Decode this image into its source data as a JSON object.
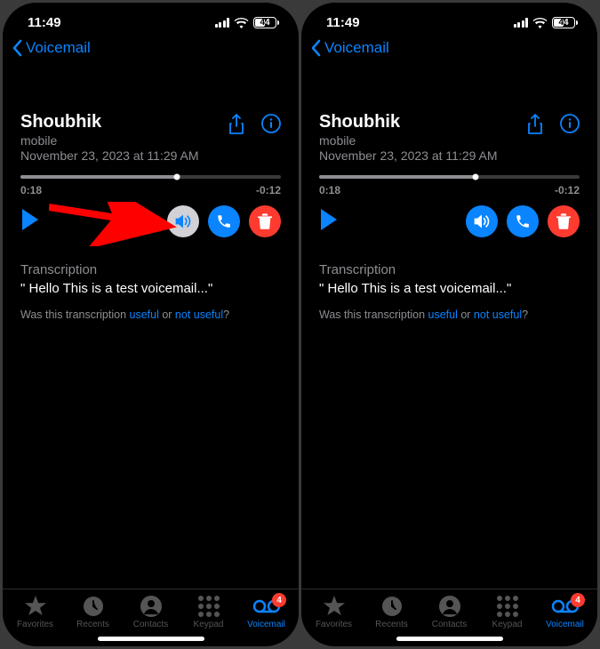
{
  "status": {
    "time": "11:49",
    "battery": "44"
  },
  "nav": {
    "back": "Voicemail"
  },
  "voicemail": {
    "name": "Shoubhik",
    "type": "mobile",
    "date": "November 23, 2023 at 11:29 AM",
    "elapsed": "0:18",
    "remaining": "-0:12",
    "progress_pct": 60
  },
  "transcription": {
    "label": "Transcription",
    "text": "\" Hello This is a test voicemail...\"",
    "feedback_prefix": "Was this transcription ",
    "useful": "useful",
    "or": " or ",
    "not_useful": "not useful",
    "q": "?"
  },
  "tabs": {
    "favorites": "Favorites",
    "recents": "Recents",
    "contacts": "Contacts",
    "keypad": "Keypad",
    "voicemail": "Voicemail",
    "badge": "4"
  },
  "left": {
    "speaker_variant": "grey"
  },
  "right": {
    "speaker_variant": "blue"
  }
}
